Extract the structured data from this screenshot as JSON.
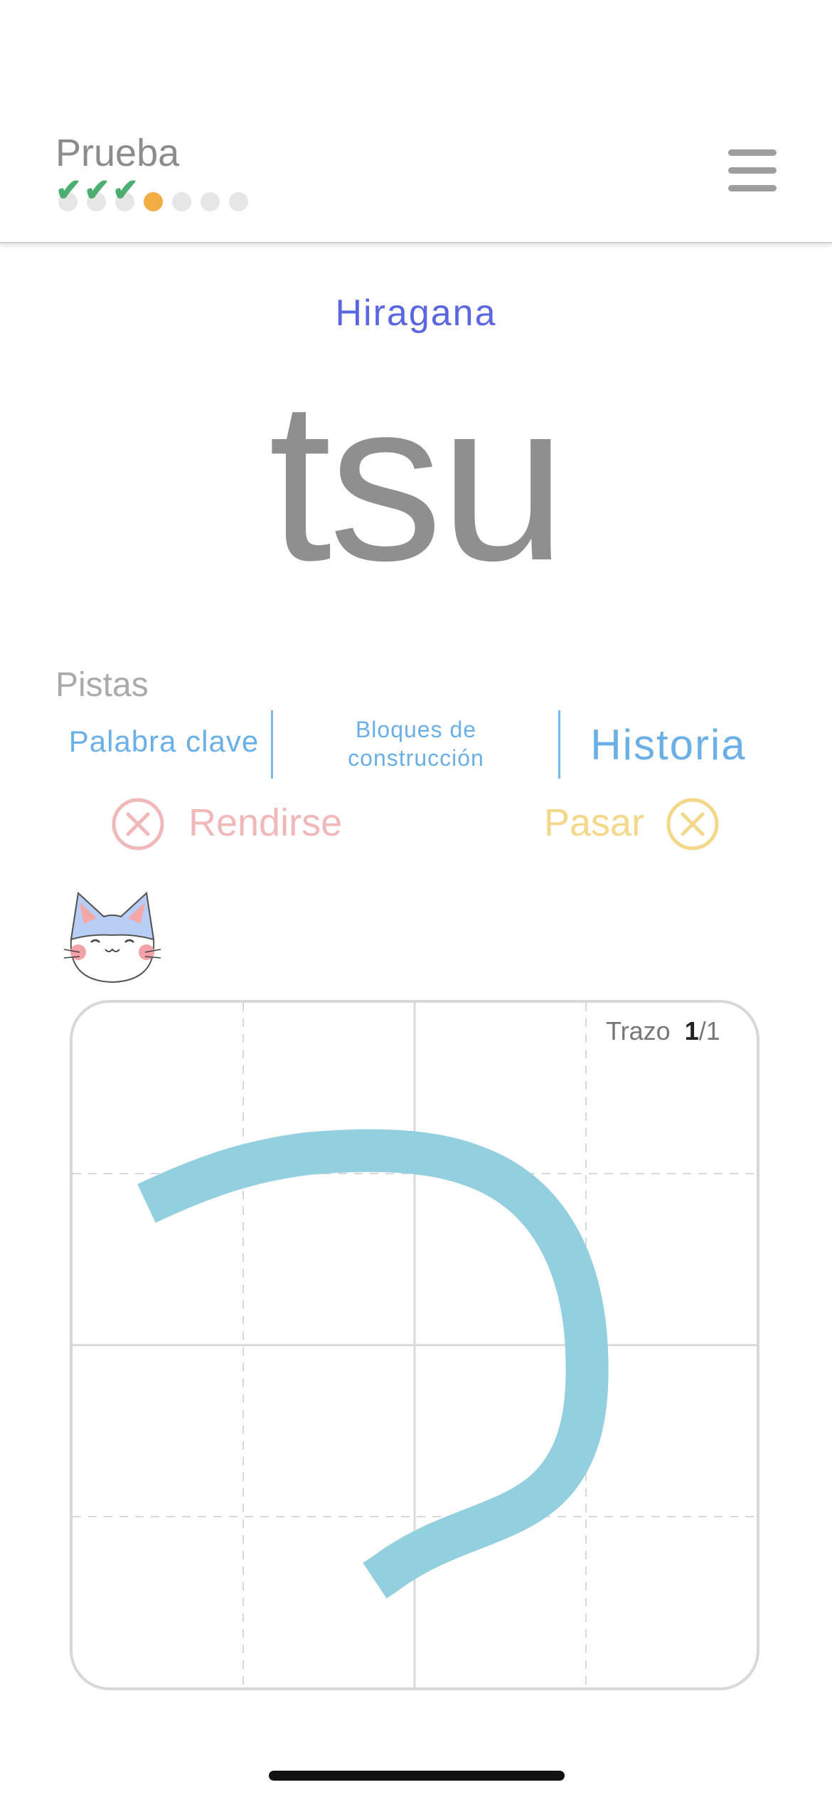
{
  "header": {
    "title": "Prueba",
    "progress": {
      "items": [
        "done",
        "done",
        "done",
        "current",
        "pending",
        "pending",
        "pending"
      ],
      "check_glyph": "✔"
    },
    "menu_icon": "hamburger-menu-icon"
  },
  "quiz": {
    "script_type": "Hiragana",
    "romaji": "tsu"
  },
  "hints": {
    "label": "Pistas",
    "keyword": "Palabra clave",
    "building_blocks_line1": "Bloques de",
    "building_blocks_line2": "construcción",
    "story": "Historia"
  },
  "actions": {
    "give_up": "Rendirse",
    "skip": "Pasar",
    "give_up_icon": "x-circle-icon",
    "skip_icon": "x-circle-icon",
    "give_up_color": "#f0b8b8",
    "skip_color": "#f2d888"
  },
  "mascot": {
    "icon": "cat-face-icon"
  },
  "drawing_board": {
    "stroke_label": "Trazo",
    "stroke_current": "1",
    "stroke_total": "/1",
    "stroke_color": "#94cfdf",
    "grid_color": "#d8d8d8"
  },
  "colors": {
    "accent": "#5b67e0",
    "hint_blue": "#6aafe6",
    "check_green": "#4caf72",
    "current_orange": "#f2ad45"
  }
}
